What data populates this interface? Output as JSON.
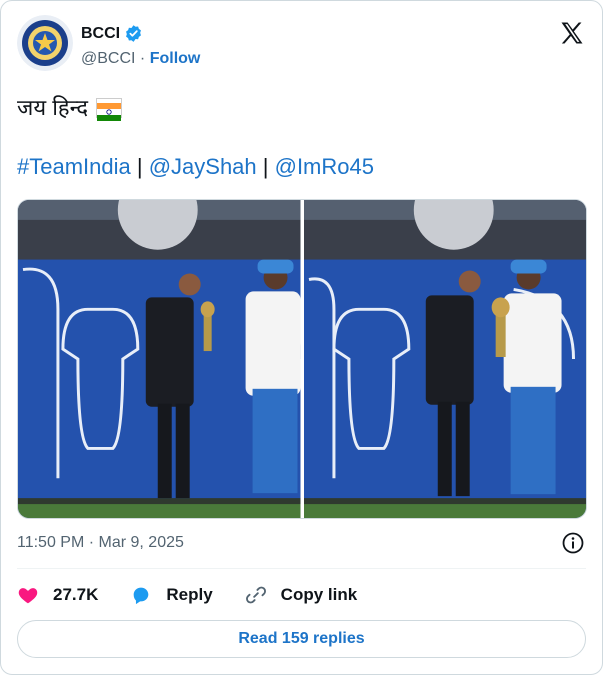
{
  "account": {
    "name": "BCCI",
    "handle": "@BCCI",
    "separator": "·",
    "follow_label": "Follow"
  },
  "tweet": {
    "line1": "जय हिन्द",
    "hashtag": "#TeamIndia",
    "sep": " | ",
    "mention1": "@JayShah",
    "mention2": "@ImRo45",
    "timestamp": "11:50 PM · Mar 9, 2025"
  },
  "actions": {
    "likes": "27.7K",
    "reply_label": "Reply",
    "copy_label": "Copy link"
  },
  "read_replies_label": "Read 159 replies",
  "icons": [
    "verified-badge-icon",
    "x-logo-icon",
    "india-flag-icon",
    "heart-icon",
    "reply-icon",
    "link-icon",
    "info-icon"
  ],
  "colors": {
    "link": "#1d74c8",
    "heart": "#f91880",
    "text": "#0f1419",
    "secondary": "#536471"
  }
}
